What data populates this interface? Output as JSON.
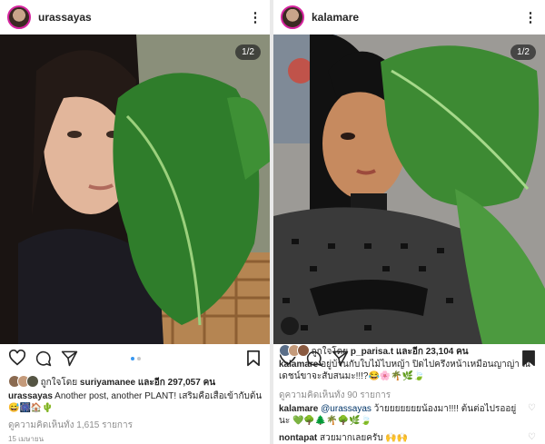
{
  "post1": {
    "username": "urassayas",
    "counter": "1/2",
    "likes": {
      "prefix": "ถูกใจโดย",
      "user": "suriyamanee",
      "rest": "และอีก 297,057 คน"
    },
    "caption": {
      "user": "urassayas",
      "text": "Another post, another PLANT! เสริมคือเสื้อเข้ากับต้น 😅🎆🏠🌵"
    },
    "view_comments": "ดูความคิดเห็นทั้ง 1,615 รายการ",
    "timestamp": "15 เมษายน"
  },
  "post2": {
    "username": "kalamare",
    "counter": "1/2",
    "likes": {
      "prefix": "ถูกใจโดย",
      "user": "p_parisa.t",
      "rest": "และอีก 23,104 คน"
    },
    "caption": {
      "user": "kalamare",
      "text": "อยู่บ้านกับใบไม้ไบหญ้า ปิดไปครึ่งหน้าเหมือนญาญ่า ณเดชน์ขาจะสับสนมะ!!!?😂🌸🌴🌿🍃"
    },
    "view_comments": "ดูความคิดเห็นทั้ง 90 รายการ",
    "comment1": {
      "user": "kalamare",
      "mention": "@urassayas",
      "text": "ว้ายยยยยยยน้องมา!!!! ต้นต่อไปรออยู่นะ 💚🌳🌲🌴🌳🌿🍃"
    },
    "comment2": {
      "user": "nontapat",
      "text": "สวยมากเลยครับ 🙌🙌"
    }
  },
  "colors": {
    "accent": "#3897f0",
    "ring": "#d6249f"
  }
}
